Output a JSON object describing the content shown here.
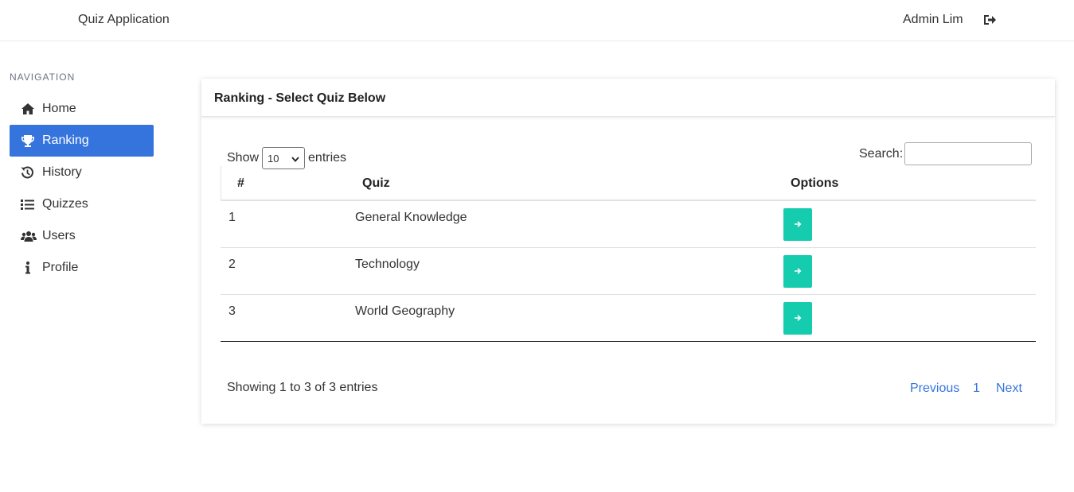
{
  "header": {
    "app_title": "Quiz Application",
    "user_name": "Admin Lim",
    "logout_icon": "sign-out-icon"
  },
  "sidebar": {
    "heading": "NAVIGATION",
    "items": [
      {
        "label": "Home",
        "icon": "home-icon",
        "active": false
      },
      {
        "label": "Ranking",
        "icon": "trophy-icon",
        "active": true
      },
      {
        "label": "History",
        "icon": "history-icon",
        "active": false
      },
      {
        "label": "Quizzes",
        "icon": "list-icon",
        "active": false
      },
      {
        "label": "Users",
        "icon": "users-icon",
        "active": false
      },
      {
        "label": "Profile",
        "icon": "info-icon",
        "active": false
      }
    ],
    "active_color": "#3574dd"
  },
  "card": {
    "title": "Ranking - Select Quiz Below"
  },
  "table_controls": {
    "show_label": "Show",
    "entries_label": "entries",
    "page_size": "10",
    "search_label": "Search:",
    "search_value": ""
  },
  "table": {
    "columns": [
      "#",
      "Quiz",
      "Options"
    ],
    "rows": [
      {
        "num": "1",
        "quiz": "General Knowledge"
      },
      {
        "num": "2",
        "quiz": "Technology"
      },
      {
        "num": "3",
        "quiz": "World Geography"
      }
    ],
    "action_icon": "arrow-right-icon",
    "action_color": "#16ccae"
  },
  "footer": {
    "info": "Showing 1 to 3 of 3 entries",
    "previous": "Previous",
    "page": "1",
    "next": "Next"
  }
}
